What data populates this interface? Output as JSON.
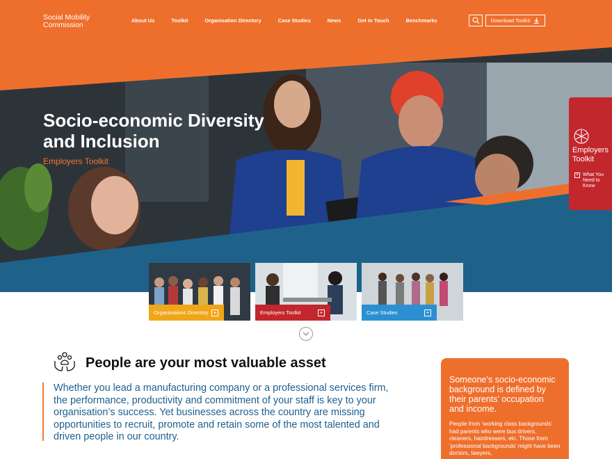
{
  "header": {
    "logo": "Social Mobility Commission",
    "nav": [
      {
        "label": "About Us"
      },
      {
        "label": "Toolkit"
      },
      {
        "label": "Organisation Directory"
      },
      {
        "label": "Case Studies"
      },
      {
        "label": "News"
      },
      {
        "label": "Get In Touch"
      },
      {
        "label": "Benchmarks"
      }
    ],
    "download_label": "Download Toolkit"
  },
  "hero": {
    "title": "Socio-economic Diversity and Inclusion",
    "subtitle": "Employers Toolkit"
  },
  "side_tab": {
    "title": "Employers Toolkit",
    "link": "What You Need to Know"
  },
  "cards": [
    {
      "label": "Organisations Directory",
      "color": "#f0a619"
    },
    {
      "label": "Employers Toolkit",
      "color": "#c1272d"
    },
    {
      "label": "Case Studies",
      "color": "#2b8fd2"
    }
  ],
  "section": {
    "heading": "People are your most valuable asset",
    "lead": "Whether you lead a manufacturing company or a professional services firm, the performance, productivity and commitment of your staff is key to your organisation’s success. Yet businesses across the country are missing opportunities to recruit, promote and retain some of the most talented and driven people in our country."
  },
  "info_box": {
    "heading": "Someone’s socio-economic background is defined by their parents’ occupation and income.",
    "body": "People from ‘working class backgrounds’ had parents who were bus drivers, cleaners, hairdressers, etc. Those from ‘professional backgrounds’ might have been doctors, lawyers,"
  },
  "colors": {
    "brand_orange": "#ee6f2c",
    "brand_blue": "#1e628a",
    "brand_red": "#c1272d"
  }
}
